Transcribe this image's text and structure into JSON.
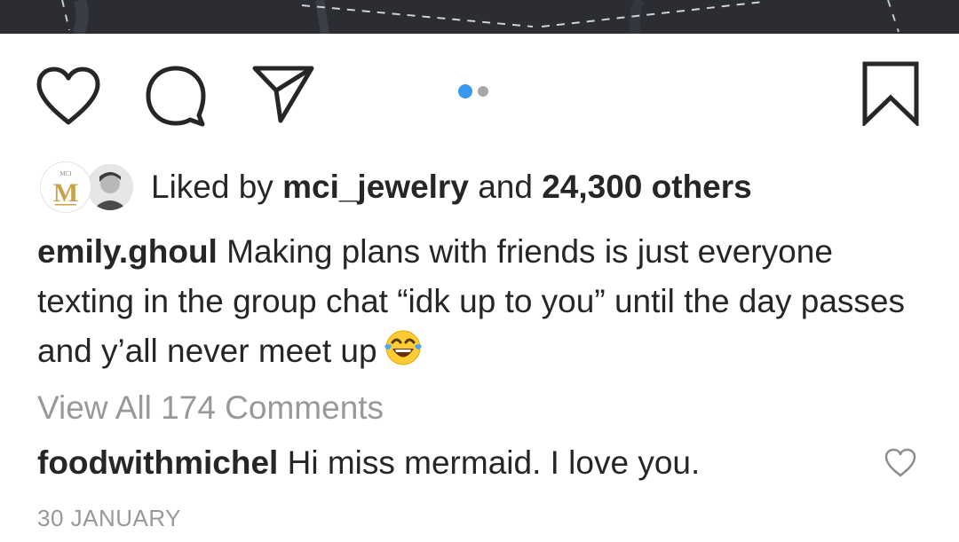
{
  "post": {
    "carousel": {
      "slide_count": 2,
      "active_slide": 1
    },
    "likes": {
      "prefix": "Liked by",
      "first_liker": "mci_jewelry",
      "connector": "and",
      "others": "24,300 others",
      "avatar_logo_text": "MCI",
      "avatar_logo_letter": "M"
    },
    "caption": {
      "username": "emily.ghoul",
      "text": "Making plans with friends is just everyone texting in the group chat “idk up to you” until the day passes and y’all never meet up",
      "emoji": "face-with-tears-of-joy"
    },
    "view_all_comments": "View All 174 Comments",
    "comments": [
      {
        "username": "foodwithmichel",
        "text": "Hi miss mermaid. I love you."
      }
    ],
    "date": "30 JANUARY"
  },
  "icons": {
    "like": "heart-icon",
    "comment": "comment-bubble-icon",
    "share": "paper-plane-icon",
    "save": "bookmark-icon",
    "comment_like": "small-heart-icon"
  },
  "colors": {
    "text": "#262626",
    "muted": "#999999",
    "accent": "#3897f0",
    "dot_inactive": "#a8a8a8",
    "gold": "#c9a24a"
  }
}
